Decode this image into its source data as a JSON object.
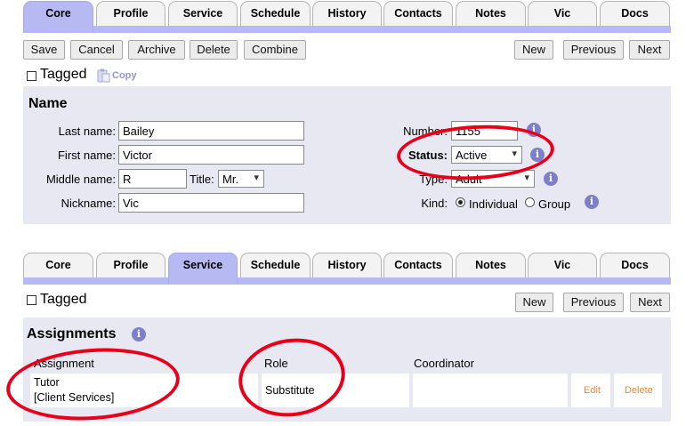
{
  "top_tabs": [
    "Core",
    "Profile",
    "Service",
    "Schedule",
    "History",
    "Contacts",
    "Notes",
    "Vic",
    "Docs"
  ],
  "top_active": "Core",
  "toolbar": {
    "save": "Save",
    "cancel": "Cancel",
    "archive": "Archive",
    "delete": "Delete",
    "combine": "Combine",
    "new": "New",
    "previous": "Previous",
    "next": "Next"
  },
  "tagged": "Tagged",
  "copy": "Copy",
  "name_section": {
    "title": "Name",
    "last_name_label": "Last name:",
    "last_name": "Bailey",
    "first_name_label": "First name:",
    "first_name": "Victor",
    "middle_name_label": "Middle name:",
    "middle_name": "R",
    "title_label": "Title:",
    "title_value": "Mr.",
    "nickname_label": "Nickname:",
    "nickname": "Vic",
    "number_label": "Number:",
    "number": "1155",
    "status_label": "Status:",
    "status": "Active",
    "type_label": "Type:",
    "type": "Adult",
    "kind_label": "Kind:",
    "kind_individual": "Individual",
    "kind_group": "Group"
  },
  "bottom_tabs": [
    "Core",
    "Profile",
    "Service",
    "Schedule",
    "History",
    "Contacts",
    "Notes",
    "Vic",
    "Docs"
  ],
  "bottom_active": "Service",
  "bottom_toolbar": {
    "new": "New",
    "previous": "Previous",
    "next": "Next"
  },
  "assignments": {
    "title": "Assignments",
    "columns": [
      "Assignment",
      "Role",
      "Coordinator"
    ],
    "row": {
      "assignment_line1": "Tutor",
      "assignment_line2": "[Client Services]",
      "role": "Substitute",
      "coordinator": "",
      "edit": "Edit",
      "delete": "Delete"
    }
  },
  "colors": {
    "tab_active": "#b6b9f2",
    "panel": "#e8e8f3",
    "annotation": "#e8001b",
    "link": "#e58a3c"
  }
}
